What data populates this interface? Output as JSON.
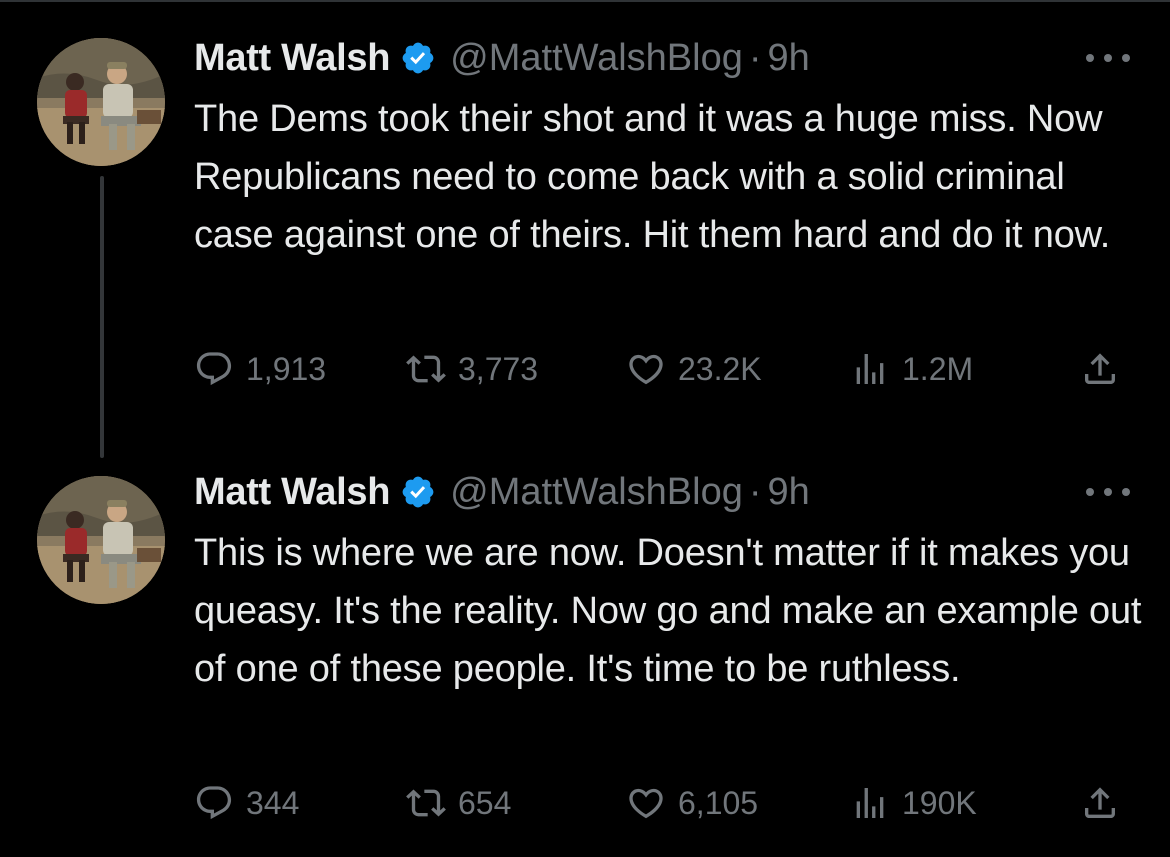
{
  "colors": {
    "background": "#000000",
    "text": "#e7e9ea",
    "muted": "#71767b",
    "verified": "#1d9bf0",
    "thread_line": "#333639"
  },
  "icons": {
    "reply": "speech-bubble-icon",
    "retweet": "retweet-arrows-icon",
    "like": "heart-icon",
    "views": "bar-chart-icon",
    "share": "share-upload-icon",
    "more": "three-dots-icon",
    "verified": "verified-badge-icon"
  },
  "tweets": [
    {
      "display_name": "Matt Walsh",
      "handle": "@MattWalshBlog",
      "separator": "·",
      "time": "9h",
      "text": "The Dems took their shot and it was a huge miss. Now Republicans need to come back with a solid criminal case against one of theirs. Hit them hard and do it now.",
      "replies": "1,913",
      "retweets": "3,773",
      "likes": "23.2K",
      "views": "1.2M"
    },
    {
      "display_name": "Matt Walsh",
      "handle": "@MattWalshBlog",
      "separator": "·",
      "time": "9h",
      "text": "This is where we are now. Doesn't matter if it makes you queasy. It's the reality. Now go and make an example out of one of these people. It's time to be ruthless.",
      "replies": "344",
      "retweets": "654",
      "likes": "6,105",
      "views": "190K"
    }
  ]
}
